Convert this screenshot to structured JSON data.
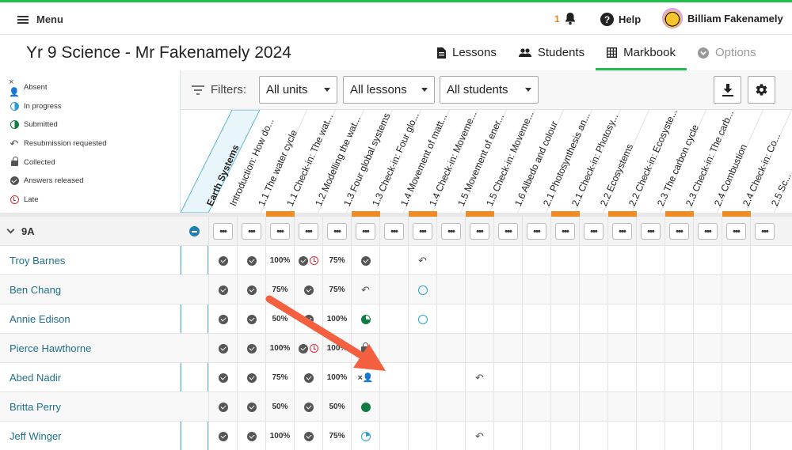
{
  "app": {
    "menu_label": "Menu",
    "notification_count": "1",
    "help_label": "Help",
    "user_name": "Billiam Fakenamely",
    "page_title": "Yr 9 Science - Mr Fakenamely 2024",
    "accent_color": "#1fbf4a"
  },
  "tabs": [
    {
      "label": "Lessons",
      "icon": "document-icon"
    },
    {
      "label": "Students",
      "icon": "people-icon"
    },
    {
      "label": "Markbook",
      "icon": "table-icon",
      "active": true
    },
    {
      "label": "Options",
      "icon": "chevron-circle-icon",
      "disabled": true
    }
  ],
  "legend": [
    {
      "label": "Absent",
      "icon": "absent-icon"
    },
    {
      "label": "In progress",
      "icon": "half-circle-icon"
    },
    {
      "label": "Submitted",
      "icon": "half-circle-green-icon"
    },
    {
      "label": "Resubmission requested",
      "icon": "undo-icon"
    },
    {
      "label": "Collected",
      "icon": "lock-icon"
    },
    {
      "label": "Answers released",
      "icon": "check-circle-icon"
    },
    {
      "label": "Late",
      "icon": "late-clock-icon"
    }
  ],
  "filters": {
    "label": "Filters:",
    "units": "All units",
    "lessons": "All lessons",
    "students": "All students"
  },
  "unit_header": "Earth Systems",
  "columns": [
    "Introduction: How do...",
    "1.1 The water cycle",
    "1.1 Check-in: The wat...",
    "1.2 Modelling the wat...",
    "1.3 Four global systems",
    "1.3 Check-in: Four glo...",
    "1.4 Movement of matt...",
    "1.4 Check-in: Moveme...",
    "1.5 Movement of ener...",
    "1.5 Check-in: Moveme...",
    "1.6 Albedo and colour",
    "2.1 Photosynthesis an...",
    "2.1 Check-in: Photosy...",
    "2.2 Ecosystems",
    "2.2 Check-in: Ecosyste...",
    "2.3 The carbon cycle",
    "2.3 Check-in: The carb...",
    "2.4 Combustion",
    "2.4 Check-in: Co...",
    "2.5 Sc..."
  ],
  "checkin_columns": [
    2,
    5,
    7,
    9,
    12,
    14,
    16,
    18
  ],
  "group": {
    "name": "9A",
    "dots": "•••"
  },
  "students": [
    {
      "name": "Troy Barnes",
      "cells": [
        "check",
        "check",
        "100%",
        "check-late",
        "75%",
        "check",
        "",
        "undo"
      ]
    },
    {
      "name": "Ben Chang",
      "cells": [
        "check",
        "check",
        "75%",
        "check",
        "75%",
        "undo",
        "",
        "ring"
      ]
    },
    {
      "name": "Annie Edison",
      "cells": [
        "check",
        "check",
        "50%",
        "check",
        "100%",
        "pie",
        "",
        "ring"
      ]
    },
    {
      "name": "Pierce Hawthorne",
      "cells": [
        "check",
        "check",
        "100%",
        "check-late",
        "100%",
        "lock",
        "",
        ""
      ]
    },
    {
      "name": "Abed Nadir",
      "cells": [
        "check",
        "check",
        "75%",
        "check",
        "100%",
        "absent",
        "",
        "",
        "",
        "undo"
      ]
    },
    {
      "name": "Britta Perry",
      "cells": [
        "check",
        "check",
        "50%",
        "check",
        "50%",
        "green",
        "",
        ""
      ]
    },
    {
      "name": "Jeff Winger",
      "cells": [
        "check",
        "check",
        "100%",
        "check",
        "75%",
        "progress",
        "",
        "",
        "",
        "undo"
      ]
    }
  ]
}
